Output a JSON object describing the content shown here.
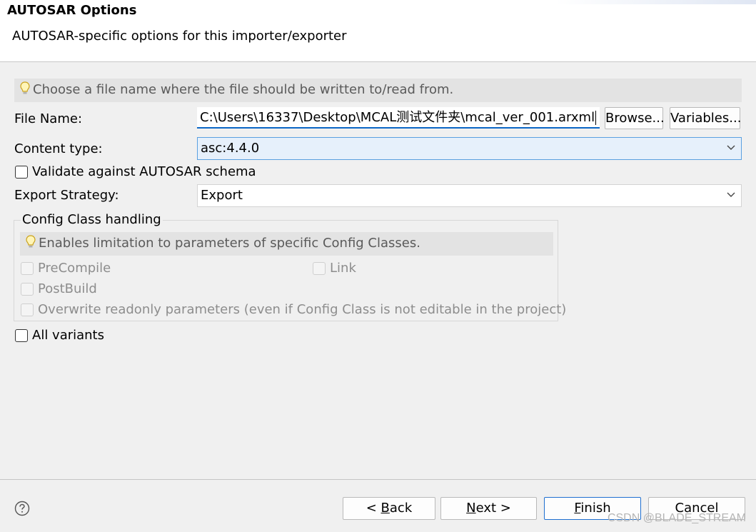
{
  "header": {
    "title": "AUTOSAR Options",
    "description": "AUTOSAR-specific options for this importer/exporter"
  },
  "info": {
    "text": "Choose a file name where the file should be written to/read from."
  },
  "file_name": {
    "label": "File Name:",
    "value": "C:\\Users\\16337\\Desktop\\MCAL测试文件夹\\mcal_ver_001.arxml",
    "browse_label": "Browse...",
    "variables_label": "Variables..."
  },
  "content_type": {
    "label": "Content type:",
    "selected": "asc:4.4.0"
  },
  "validate": {
    "label": "Validate against AUTOSAR schema",
    "checked": false
  },
  "export_strategy": {
    "label": "Export Strategy:",
    "selected": "Export"
  },
  "config_class": {
    "title": "Config Class handling",
    "info": "Enables limitation to parameters of specific Config Classes.",
    "precompile": "PreCompile",
    "link": "Link",
    "postbuild": "PostBuild",
    "overwrite": "Overwrite readonly parameters (even if Config Class is not editable in the project)"
  },
  "all_variants": {
    "label": "All variants",
    "checked": false
  },
  "footer": {
    "back_prefix": "< ",
    "back_mnemonic": "B",
    "back_rest": "ack",
    "next_mnemonic": "N",
    "next_rest": "ext >",
    "finish_mnemonic": "F",
    "finish_rest": "inish",
    "cancel_label": "Cancel"
  },
  "watermark": "CSDN @BLADE_STREAM",
  "colors": {
    "accent": "#0b66c6",
    "focus_bg": "#e6f0fb",
    "info_bg": "#e3e3e3",
    "panel_bg": "#f0f0f0"
  }
}
